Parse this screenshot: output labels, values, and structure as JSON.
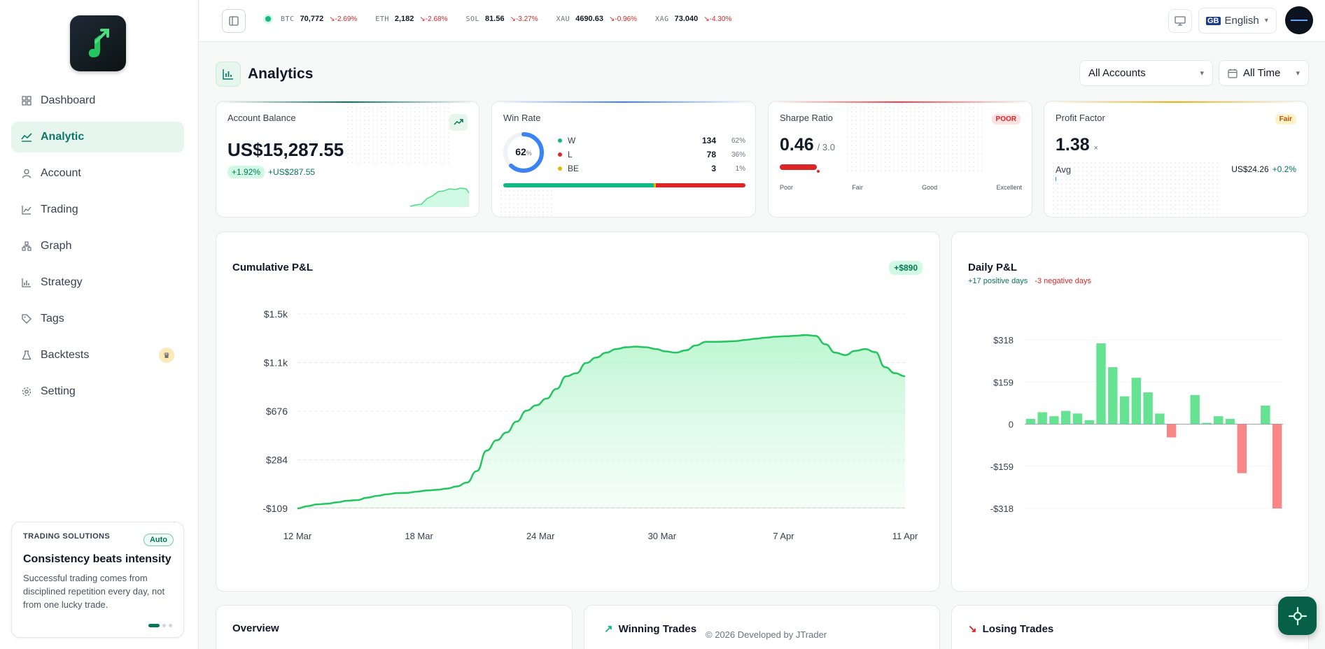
{
  "nav": {
    "items": [
      {
        "label": "Dashboard",
        "icon": "grid-icon"
      },
      {
        "label": "Analytic",
        "icon": "analytics-icon"
      },
      {
        "label": "Account",
        "icon": "user-icon"
      },
      {
        "label": "Trading",
        "icon": "line-chart-icon"
      },
      {
        "label": "Graph",
        "icon": "network-icon"
      },
      {
        "label": "Strategy",
        "icon": "bar-chart-icon"
      },
      {
        "label": "Tags",
        "icon": "tag-icon"
      },
      {
        "label": "Backtests",
        "icon": "flask-icon"
      },
      {
        "label": "Setting",
        "icon": "gear-icon"
      }
    ],
    "active": "Analytic"
  },
  "promo": {
    "kicker": "TRADING SOLUTIONS",
    "badge": "Auto",
    "title": "Consistency beats intensity",
    "body": "Successful trading comes from disciplined repetition every day, not from one lucky trade."
  },
  "ticker": [
    {
      "sym": "BTC",
      "price": "70,772",
      "change": "-2.69%"
    },
    {
      "sym": "ETH",
      "price": "2,182",
      "change": "-2.68%"
    },
    {
      "sym": "SOL",
      "price": "81.56",
      "change": "-3.27%"
    },
    {
      "sym": "XAU",
      "price": "4690.63",
      "change": "-0.96%"
    },
    {
      "sym": "XAG",
      "price": "73.040",
      "change": "-4.30%"
    }
  ],
  "header": {
    "language": "English"
  },
  "page": {
    "title": "Analytics",
    "account_filter": "All Accounts",
    "time_filter": "All Time"
  },
  "kpi": {
    "balance": {
      "label": "Account Balance",
      "value": "US$15,287.55",
      "pct": "+1.92%",
      "abs": "+US$287.55"
    },
    "winrate": {
      "label": "Win Rate",
      "pct": "62",
      "pct_sign": "%",
      "fraction": 0.62,
      "rows": [
        {
          "tag": "W",
          "count": "134",
          "pct": "62%",
          "color": "#10b981"
        },
        {
          "tag": "L",
          "count": "78",
          "pct": "36%",
          "color": "#dc2626"
        },
        {
          "tag": "BE",
          "count": "3",
          "pct": "1%",
          "color": "#eab308"
        }
      ]
    },
    "sharpe": {
      "label": "Sharpe Ratio",
      "value": "0.46",
      "max": "/ 3.0",
      "badge": "POOR",
      "scale": [
        "Poor",
        "Fair",
        "Good",
        "Excellent"
      ]
    },
    "profit_factor": {
      "label": "Profit Factor",
      "value": "1.38",
      "unit": "×",
      "badge": "Fair",
      "avg_label": "Avg",
      "avg_value": "US$24.26",
      "avg_pct": "+0.2%"
    }
  },
  "cumulative": {
    "title": "Cumulative P&L",
    "badge": "+$890"
  },
  "daily": {
    "title": "Daily P&L",
    "positive": "+17 positive days",
    "negative": "-3 negative days"
  },
  "bottom": {
    "overview": "Overview",
    "winning": "Winning Trades",
    "losing": "Losing Trades"
  },
  "footer": "© 2026 Developed by JTrader",
  "chart_data": [
    {
      "type": "area",
      "title": "Cumulative P&L",
      "x_ticks": [
        "12 Mar",
        "18 Mar",
        "24 Mar",
        "30 Mar",
        "7 Apr",
        "11 Apr"
      ],
      "y_ticks": [
        "$1.5k",
        "$1.1k",
        "$676",
        "$284",
        "-$109"
      ],
      "ylim": [
        -109,
        1500
      ],
      "values": [
        -109,
        -90,
        -75,
        -70,
        -58,
        -45,
        -40,
        -20,
        -5,
        8,
        18,
        20,
        30,
        40,
        45,
        55,
        73,
        105,
        200,
        370,
        455,
        520,
        610,
        700,
        745,
        800,
        880,
        985,
        1010,
        1095,
        1140,
        1180,
        1210,
        1225,
        1230,
        1225,
        1210,
        1190,
        1180,
        1200,
        1240,
        1270,
        1270,
        1272,
        1276,
        1286,
        1295,
        1305,
        1312,
        1316,
        1320,
        1326,
        1319,
        1250,
        1180,
        1160,
        1195,
        1210,
        1185,
        1060,
        1010,
        985
      ],
      "color": "#22c55e"
    },
    {
      "type": "bar",
      "title": "Daily P&L",
      "y_ticks": [
        "$318",
        "$159",
        "0",
        "-$159",
        "-$318"
      ],
      "ylim": [
        -318,
        318
      ],
      "values": [
        20,
        45,
        30,
        50,
        40,
        15,
        305,
        215,
        105,
        175,
        120,
        40,
        -50,
        0,
        110,
        5,
        30,
        20,
        -185,
        0,
        70,
        -318
      ],
      "pos_color": "#4ade80",
      "neg_color": "#f87171"
    }
  ]
}
